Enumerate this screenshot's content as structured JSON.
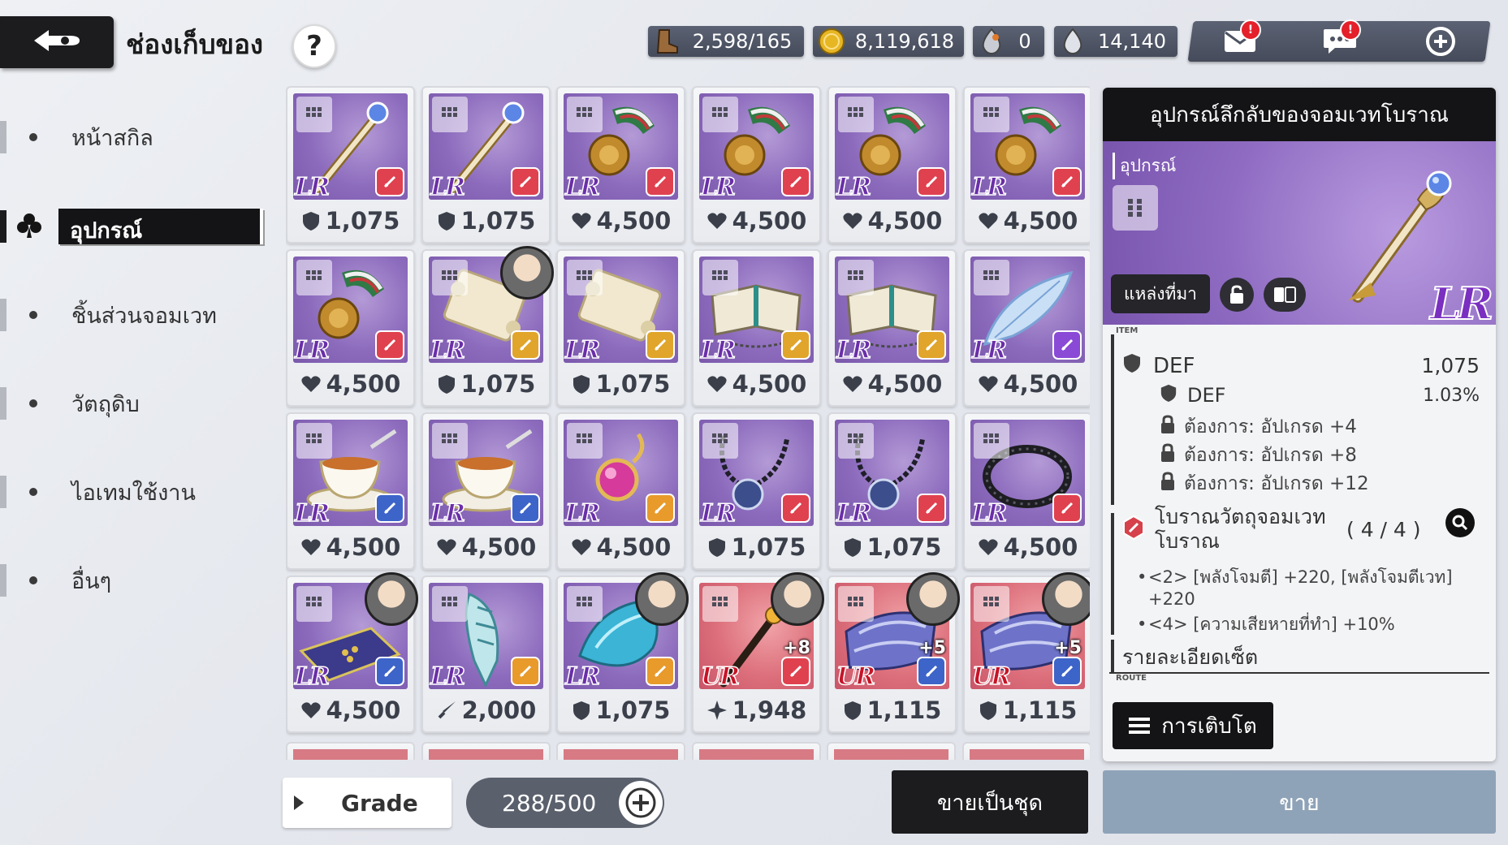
{
  "header": {
    "title": "ช่องเก็บของ",
    "help_label": "?",
    "resources": [
      {
        "icon": "stamina-boot-icon",
        "value": "2,598/165"
      },
      {
        "icon": "gold-coin-icon",
        "value": "8,119,618"
      },
      {
        "icon": "clover-crystal-icon",
        "value": "0"
      },
      {
        "icon": "magic-crystal-icon",
        "value": "14,140"
      }
    ],
    "alert_badge": "!"
  },
  "sidebar": {
    "items": [
      {
        "label": "หน้าสกิล"
      },
      {
        "label": "อุปกรณ์"
      },
      {
        "label": "ชิ้นส่วนจอมเวท"
      },
      {
        "label": "วัตถุดิบ"
      },
      {
        "label": "ไอเทมใช้งาน"
      },
      {
        "label": "อื่นๆ"
      }
    ],
    "active_index": 1
  },
  "inventory": {
    "items": [
      {
        "grade": "LR",
        "art": "staff",
        "element": "red",
        "stat_icon": "shield",
        "stat": "1,075"
      },
      {
        "grade": "LR",
        "art": "staff",
        "element": "red",
        "stat_icon": "shield",
        "stat": "1,075"
      },
      {
        "grade": "LR",
        "art": "medal",
        "element": "red",
        "stat_icon": "heart",
        "stat": "4,500"
      },
      {
        "grade": "LR",
        "art": "medal",
        "element": "red",
        "stat_icon": "heart",
        "stat": "4,500"
      },
      {
        "grade": "LR",
        "art": "medal",
        "element": "red",
        "stat_icon": "heart",
        "stat": "4,500"
      },
      {
        "grade": "LR",
        "art": "medal",
        "element": "red",
        "stat_icon": "heart",
        "stat": "4,500"
      },
      {
        "grade": "LR",
        "art": "medal",
        "element": "red",
        "stat_icon": "heart",
        "stat": "4,500"
      },
      {
        "grade": "LR",
        "art": "scroll",
        "element": "gold",
        "stat_icon": "shield",
        "stat": "1,075",
        "portrait": true
      },
      {
        "grade": "LR",
        "art": "scroll",
        "element": "gold",
        "stat_icon": "shield",
        "stat": "1,075"
      },
      {
        "grade": "LR",
        "art": "book",
        "element": "gold",
        "stat_icon": "heart",
        "stat": "4,500"
      },
      {
        "grade": "LR",
        "art": "book",
        "element": "gold",
        "stat_icon": "heart",
        "stat": "4,500"
      },
      {
        "grade": "LR",
        "art": "feather",
        "element": "purple",
        "stat_icon": "heart",
        "stat": "4,500"
      },
      {
        "grade": "LR",
        "art": "teacup",
        "element": "blue",
        "stat_icon": "heart",
        "stat": "4,500"
      },
      {
        "grade": "LR",
        "art": "teacup",
        "element": "blue",
        "stat_icon": "heart",
        "stat": "4,500"
      },
      {
        "grade": "LR",
        "art": "pendant",
        "element": "orange",
        "stat_icon": "heart",
        "stat": "4,500"
      },
      {
        "grade": "LR",
        "art": "necklace",
        "element": "red",
        "stat_icon": "shield",
        "stat": "1,075"
      },
      {
        "grade": "LR",
        "art": "necklace",
        "element": "red",
        "stat_icon": "shield",
        "stat": "1,075"
      },
      {
        "grade": "LR",
        "art": "thorn",
        "element": "red",
        "stat_icon": "heart",
        "stat": "4,500"
      },
      {
        "grade": "LR",
        "art": "carpet",
        "element": "blue",
        "stat_icon": "heart",
        "stat": "4,500",
        "portrait": true
      },
      {
        "grade": "LR",
        "art": "shell",
        "element": "orange",
        "stat_icon": "sword",
        "stat": "2,000"
      },
      {
        "grade": "LR",
        "art": "gem",
        "element": "orange",
        "stat_icon": "shield",
        "stat": "1,075",
        "portrait": true
      },
      {
        "grade": "UR",
        "art": "wand",
        "element": "red",
        "stat_icon": "star",
        "stat": "1,948",
        "plus": "+8",
        "portrait": true
      },
      {
        "grade": "UR",
        "art": "gauntlet",
        "element": "blue",
        "stat_icon": "shield",
        "stat": "1,115",
        "plus": "+5",
        "portrait": true
      },
      {
        "grade": "UR",
        "art": "gauntlet",
        "element": "blue",
        "stat_icon": "shield",
        "stat": "1,115",
        "plus": "+5",
        "portrait": true
      }
    ]
  },
  "detail": {
    "title": "อุปกรณ์ลึกลับของจอมเวทโบราณ",
    "category": "อุปกรณ์",
    "grade": "LR",
    "source_label": "แหล่งที่มา",
    "section_item_label": "ITEM",
    "main_stat": {
      "name": "DEF",
      "value": "1,075"
    },
    "sub_stat": {
      "name": "DEF",
      "value": "1.03%"
    },
    "requirements": [
      "ต้องการ: อัปเกรด +4",
      "ต้องการ: อัปเกรด +8",
      "ต้องการ: อัปเกรด +12"
    ],
    "set_name": "โบราณวัตถุจอมเวทโบราณ",
    "set_count": "( 4 / 4 )",
    "set_bonus_2": "<2> [พลังโจมตี] +220, [พลังโจมตีเวท] +220",
    "set_bonus_4": "<4> [ความเสียหายที่ทำ] +10%",
    "set_detail_label": "รายละเอียดเซ็ต",
    "section_route_label": "ROUTE",
    "growth_button": "การเติบโต"
  },
  "footer": {
    "grade_button": "Grade",
    "capacity": "288/500",
    "bulk_sell": "ขายเป็นชุด",
    "sell": "ขาย"
  },
  "colors": {
    "lr_purple": "#8c6bbd",
    "ur_red": "#dc6f7b",
    "panel_dark": "#141416",
    "sell_blue": "#8fa3b8"
  }
}
